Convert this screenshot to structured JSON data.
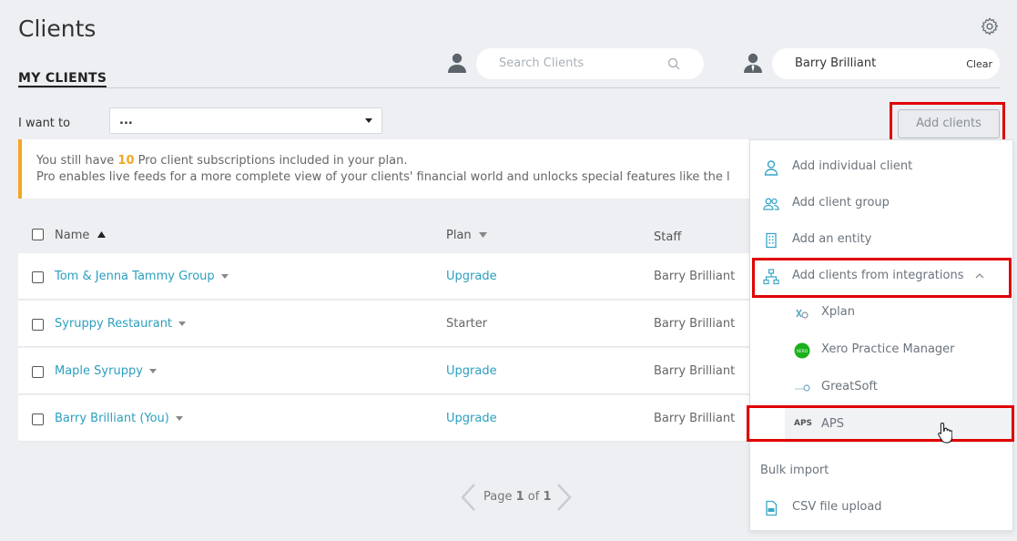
{
  "page": {
    "title": "Clients",
    "settings_icon": "gear-icon"
  },
  "tabs": [
    {
      "label": "MY CLIENTS",
      "active": true
    }
  ],
  "search": {
    "placeholder": "Search Clients",
    "icon": "search-icon"
  },
  "staff_filter": {
    "value": "Barry Brilliant",
    "clear_label": "Clear"
  },
  "action_select": {
    "label": "I want to",
    "value": "..."
  },
  "add_clients_button": {
    "label": "Add clients"
  },
  "banner": {
    "line1_prefix": "You still have ",
    "count": "10",
    "line1_suffix": " Pro client subscriptions included in your plan.",
    "line2": "Pro enables live feeds for a more complete view of your clients' financial world and unlocks special features like the l",
    "accent_color": "#f5a623"
  },
  "table": {
    "columns": {
      "name": "Name",
      "plan": "Plan",
      "staff": "Staff"
    },
    "rows": [
      {
        "name": "Tom & Jenna Tammy Group",
        "plan": "Upgrade",
        "plan_is_link": true,
        "staff": "Barry Brilliant"
      },
      {
        "name": "Syruppy Restaurant",
        "plan": "Starter",
        "plan_is_link": false,
        "staff": "Barry Brilliant"
      },
      {
        "name": "Maple Syruppy",
        "plan": "Upgrade",
        "plan_is_link": true,
        "staff": "Barry Brilliant"
      },
      {
        "name": "Barry Brilliant (You)",
        "plan": "Upgrade",
        "plan_is_link": true,
        "staff": "Barry Brilliant"
      }
    ]
  },
  "pagination": {
    "prefix": "Page ",
    "current": "1",
    "middle": " of ",
    "total": "1"
  },
  "add_menu": {
    "items": [
      {
        "label": "Add individual client",
        "icon": "person-outline-icon"
      },
      {
        "label": "Add client group",
        "icon": "group-icon"
      },
      {
        "label": "Add an entity",
        "icon": "building-icon"
      },
      {
        "label": "Add clients from integrations",
        "icon": "hierarchy-icon",
        "expanded": true
      }
    ],
    "integrations": [
      {
        "label": "Xplan",
        "icon": "xplan-logo-icon"
      },
      {
        "label": "Xero Practice Manager",
        "icon": "xero-logo-icon"
      },
      {
        "label": "GreatSoft",
        "icon": "greatsoft-logo-icon"
      },
      {
        "label": "APS",
        "icon": "aps-logo-icon",
        "logo_text": "APS",
        "hovered": true
      }
    ],
    "bulk_import": {
      "heading": "Bulk import",
      "items": [
        {
          "label": "CSV file upload",
          "icon": "csv-file-icon"
        }
      ]
    }
  },
  "colors": {
    "link": "#2b9fbf",
    "highlight_box": "#e00000",
    "background": "#edeff2"
  }
}
